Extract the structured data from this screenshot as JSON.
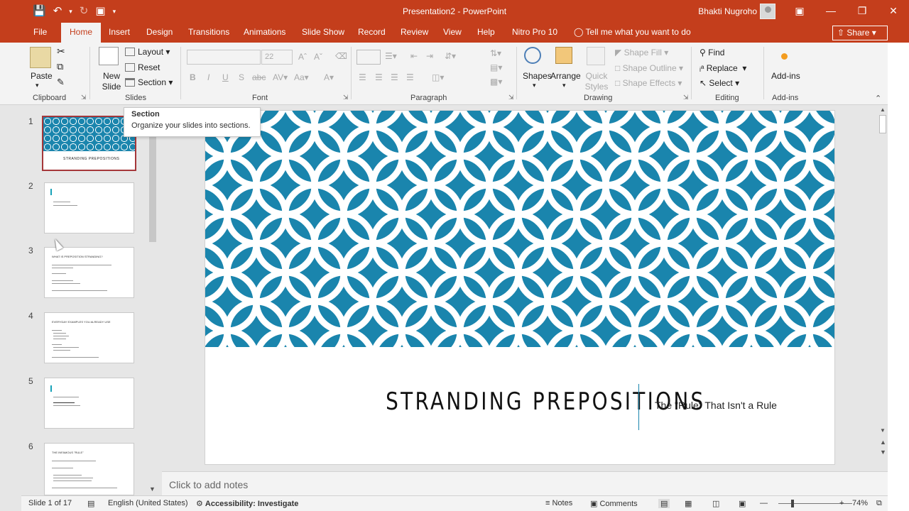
{
  "window": {
    "title": "Presentation2 - PowerPoint",
    "user": "Bhakti Nugroho"
  },
  "tabs": [
    {
      "label": "File"
    },
    {
      "label": "Home"
    },
    {
      "label": "Insert"
    },
    {
      "label": "Design"
    },
    {
      "label": "Transitions"
    },
    {
      "label": "Animations"
    },
    {
      "label": "Slide Show"
    },
    {
      "label": "Record"
    },
    {
      "label": "Review"
    },
    {
      "label": "View"
    },
    {
      "label": "Help"
    },
    {
      "label": "Nitro Pro 10"
    }
  ],
  "tell_me": "Tell me what you want to do",
  "share_label": "Share",
  "ribbon": {
    "clipboard": {
      "paste": "Paste",
      "label": "Clipboard"
    },
    "slides": {
      "new_slide": "New Slide",
      "layout": "Layout",
      "reset": "Reset",
      "section": "Section",
      "label": "Slides"
    },
    "font": {
      "size": "22",
      "label": "Font"
    },
    "paragraph": {
      "label": "Paragraph"
    },
    "drawing": {
      "shapes": "Shapes",
      "arrange": "Arrange",
      "quick_styles": "Quick Styles",
      "shape_fill": "Shape Fill",
      "shape_outline": "Shape Outline",
      "shape_effects": "Shape Effects",
      "label": "Drawing"
    },
    "editing": {
      "find": "Find",
      "replace": "Replace",
      "select": "Select",
      "label": "Editing"
    },
    "addins": {
      "button": "Add-ins",
      "label": "Add-ins"
    }
  },
  "tooltip": {
    "title": "Section",
    "description": "Organize your slides into sections."
  },
  "thumbnails": [
    {
      "num": "1",
      "selected": true,
      "heading": "STRANDING PREPOSITIONS"
    },
    {
      "num": "2",
      "selected": false,
      "heading": ""
    },
    {
      "num": "3",
      "selected": false,
      "heading": "WHAT IS PREPOSITION STRANDING?"
    },
    {
      "num": "4",
      "selected": false,
      "heading": "EVERYDAY EXAMPLES YOU ALREADY USE"
    },
    {
      "num": "5",
      "selected": false,
      "heading": ""
    },
    {
      "num": "6",
      "selected": false,
      "heading": "THE INFAMOUS \"RULE\""
    }
  ],
  "slide": {
    "title": "STRANDING PREPOSITIONS",
    "subtitle": "The \"Rule\" That Isn't a Rule",
    "pattern_color": "#1a85ad"
  },
  "notes_placeholder": "Click to add notes",
  "status": {
    "slide_info": "Slide 1 of 17",
    "language": "English (United States)",
    "accessibility": "Accessibility: Investigate",
    "notes": "Notes",
    "comments": "Comments",
    "zoom": "74%"
  },
  "colors": {
    "accent": "#c43e1c",
    "selected_border": "#a5373a"
  }
}
